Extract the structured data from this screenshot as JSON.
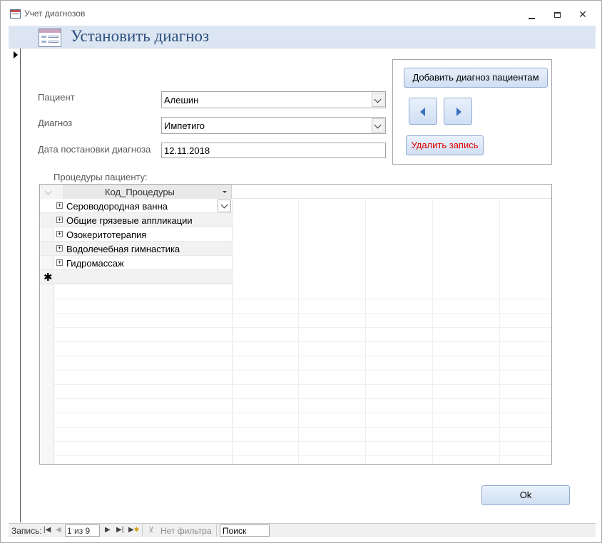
{
  "window": {
    "title": "Учет диагнозов",
    "minimize_icon": "minimize-icon",
    "restore_icon": "restore-icon",
    "close_icon": "close-icon"
  },
  "header": {
    "title": "Установить диагноз",
    "form_icon": "form-icon"
  },
  "fields": {
    "patient_label": "Пациент",
    "patient_value": "Алешин",
    "diagnosis_label": "Диагноз",
    "diagnosis_value": "Импетиго",
    "date_label": "Дата постановки диагноза",
    "date_value": "12.11.2018"
  },
  "commands": {
    "add_label": "Добавить диагноз пациентам",
    "prev_icon": "triangle-left-icon",
    "next_icon": "triangle-right-icon",
    "delete_label": "Удалить запись",
    "delete_color": "#e00000"
  },
  "subform": {
    "label": "Процедуры пациенту:",
    "column_header": "Код_Процедуры",
    "rows": [
      "Сероводородная ванна",
      "Общие грязевые аппликации",
      "Озокеритотерапия",
      "Водолечебная гимнастика",
      "Гидромассаж"
    ],
    "new_row_marker": "✱"
  },
  "ok_label": "Ok",
  "navigation": {
    "record_label": "Запись:",
    "position": "1 из 9",
    "filter_label": "Нет фильтра",
    "search_value": "Поиск"
  },
  "colors": {
    "header_band": "#dce6f2",
    "title_color": "#2d4f7c",
    "button_border": "#8ea9d1"
  }
}
